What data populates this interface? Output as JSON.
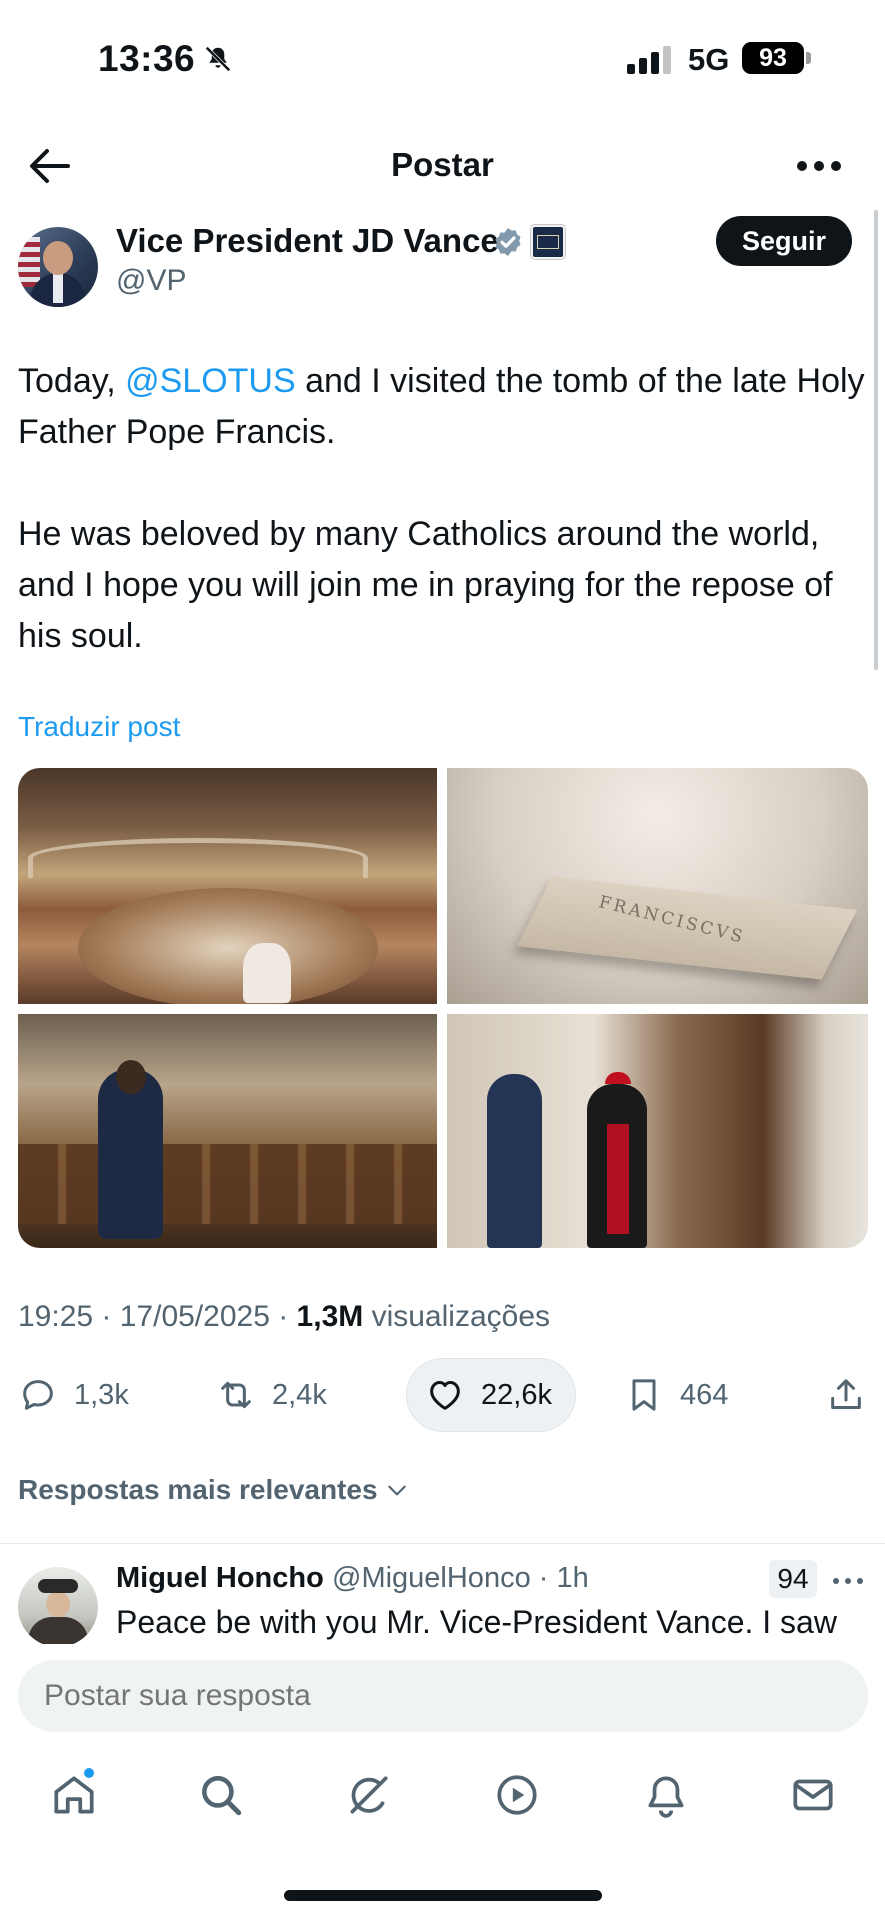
{
  "status_bar": {
    "time": "13:36",
    "network": "5G",
    "battery": "93"
  },
  "header": {
    "title": "Postar"
  },
  "author": {
    "name": "Vice President JD Vance",
    "handle": "@VP",
    "follow_label": "Seguir"
  },
  "post": {
    "text_before_mention": "Today, ",
    "mention": "@SLOTUS",
    "text_after_mention": " and I visited the tomb of the late Holy Father Pope Francis.\n\nHe was beloved by many Catholics around the world, and I hope you will join me in praying for the repose of his soul.",
    "translate_label": "Traduzir post",
    "tomb_inscription": "FRANCISCVS"
  },
  "meta": {
    "time_date": "19:25 · 17/05/2025 · ",
    "views_count": "1,3M",
    "views_label": " visualizações"
  },
  "actions": {
    "replies": "1,3k",
    "reposts": "2,4k",
    "likes": "22,6k",
    "bookmarks": "464"
  },
  "replies_sort": {
    "label": "Respostas mais relevantes"
  },
  "reply": {
    "name": "Miguel Honcho",
    "handle_time": "@MiguelHonco · 1h",
    "badge": "94",
    "text": "Peace be with you Mr. Vice-President Vance. I saw"
  },
  "composer": {
    "placeholder": "Postar sua resposta"
  },
  "nav": {
    "items": [
      "home-icon",
      "search-icon",
      "grok-icon",
      "video-icon",
      "notifications-icon",
      "messages-icon"
    ]
  },
  "colors": {
    "accent": "#1d9bf0",
    "text": "#0f1419",
    "secondary": "#536471"
  }
}
